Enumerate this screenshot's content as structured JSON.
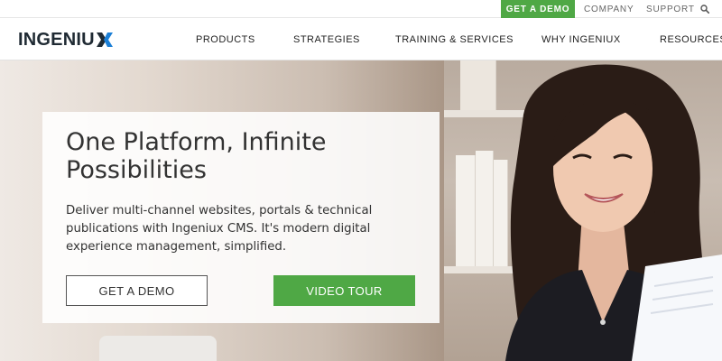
{
  "utility": {
    "demo_label": "GET A DEMO",
    "company_label": "COMPANY",
    "support_label": "SUPPORT",
    "search_icon": "search-icon"
  },
  "header": {
    "logo_text": "INGENIU",
    "logo_icon": "ingeniux-x-logo-icon"
  },
  "nav": {
    "items": [
      {
        "label": "PRODUCTS"
      },
      {
        "label": "STRATEGIES"
      },
      {
        "label": "TRAINING & SERVICES"
      },
      {
        "label": "WHY INGENIUX"
      },
      {
        "label": "RESOURCES"
      }
    ]
  },
  "hero": {
    "title": "One Platform, Infinite Possibilities",
    "description": "Deliver multi-channel websites, portals & technical publications with Ingeniux CMS. It's modern digital experience management, simplified.",
    "primary_button": "GET A DEMO",
    "secondary_button": "VIDEO TOUR"
  },
  "colors": {
    "accent_green": "#4fa845",
    "logo_blue": "#1b7fd6",
    "logo_dark": "#1f2a33"
  }
}
